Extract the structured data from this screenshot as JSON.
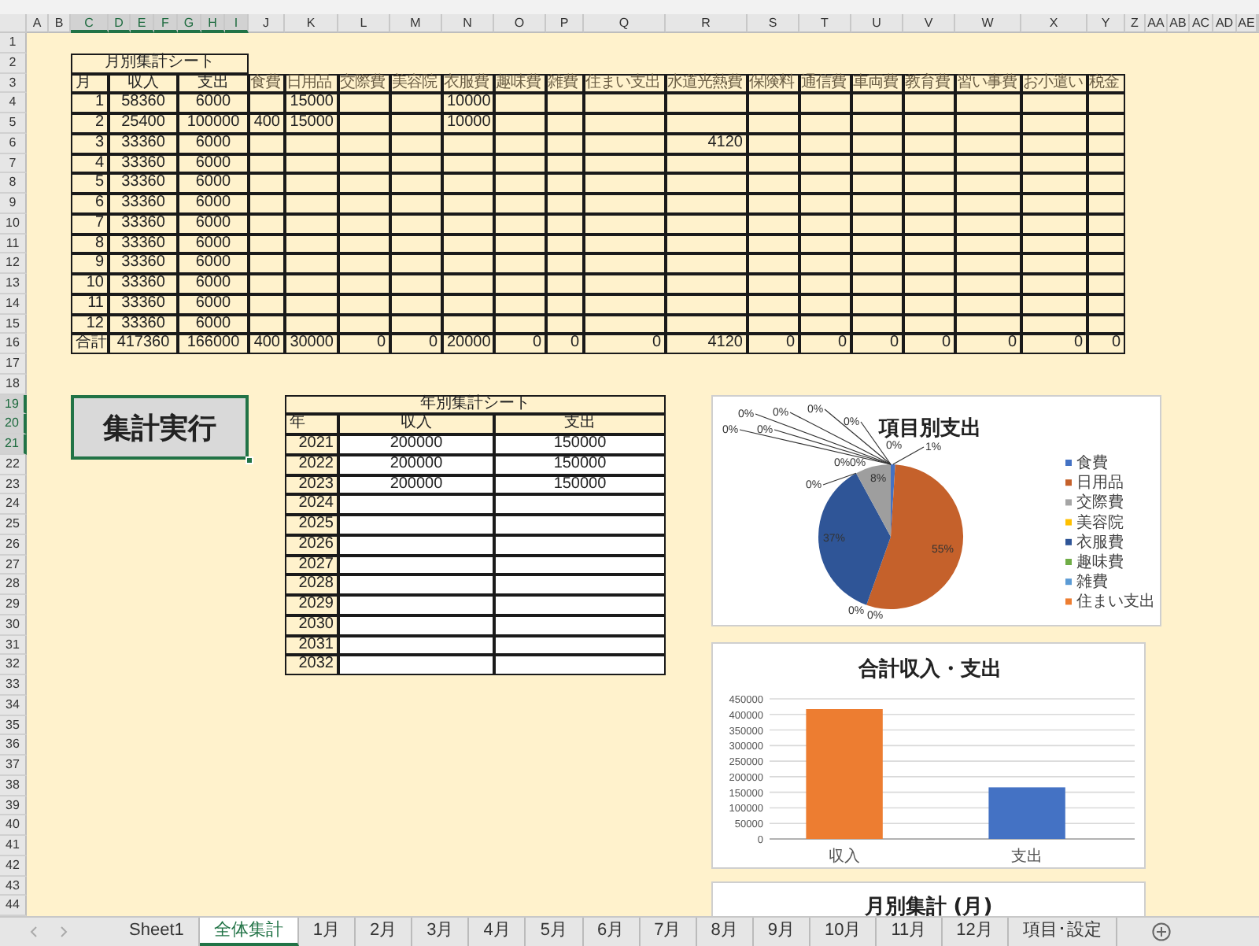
{
  "column_headers": [
    {
      "label": "A",
      "selected": false
    },
    {
      "label": "B",
      "selected": false
    },
    {
      "label": "C",
      "selected": true
    },
    {
      "label": "D",
      "selected": true
    },
    {
      "label": "E",
      "selected": true
    },
    {
      "label": "F",
      "selected": true
    },
    {
      "label": "G",
      "selected": true
    },
    {
      "label": "H",
      "selected": true
    },
    {
      "label": "I",
      "selected": true
    },
    {
      "label": "J",
      "selected": false
    },
    {
      "label": "K",
      "selected": false
    },
    {
      "label": "L",
      "selected": false
    },
    {
      "label": "M",
      "selected": false
    },
    {
      "label": "N",
      "selected": false
    },
    {
      "label": "O",
      "selected": false
    },
    {
      "label": "P",
      "selected": false
    },
    {
      "label": "Q",
      "selected": false
    },
    {
      "label": "R",
      "selected": false
    },
    {
      "label": "S",
      "selected": false
    },
    {
      "label": "T",
      "selected": false
    },
    {
      "label": "U",
      "selected": false
    },
    {
      "label": "V",
      "selected": false
    },
    {
      "label": "W",
      "selected": false
    },
    {
      "label": "X",
      "selected": false
    },
    {
      "label": "Y",
      "selected": false
    },
    {
      "label": "Z",
      "selected": false
    },
    {
      "label": "AA",
      "selected": false
    },
    {
      "label": "AB",
      "selected": false
    },
    {
      "label": "AC",
      "selected": false
    },
    {
      "label": "AD",
      "selected": false
    },
    {
      "label": "AE",
      "selected": false
    }
  ],
  "row_headers": [
    {
      "label": "1",
      "selected": false
    },
    {
      "label": "2",
      "selected": false
    },
    {
      "label": "3",
      "selected": false
    },
    {
      "label": "4",
      "selected": false
    },
    {
      "label": "5",
      "selected": false
    },
    {
      "label": "6",
      "selected": false
    },
    {
      "label": "7",
      "selected": false
    },
    {
      "label": "8",
      "selected": false
    },
    {
      "label": "9",
      "selected": false
    },
    {
      "label": "10",
      "selected": false
    },
    {
      "label": "11",
      "selected": false
    },
    {
      "label": "12",
      "selected": false
    },
    {
      "label": "13",
      "selected": false
    },
    {
      "label": "14",
      "selected": false
    },
    {
      "label": "15",
      "selected": false
    },
    {
      "label": "16",
      "selected": false
    },
    {
      "label": "17",
      "selected": false
    },
    {
      "label": "18",
      "selected": false
    },
    {
      "label": "19",
      "selected": true
    },
    {
      "label": "20",
      "selected": true
    },
    {
      "label": "21",
      "selected": true
    },
    {
      "label": "22",
      "selected": false
    },
    {
      "label": "23",
      "selected": false
    },
    {
      "label": "24",
      "selected": false
    },
    {
      "label": "25",
      "selected": false
    },
    {
      "label": "26",
      "selected": false
    },
    {
      "label": "27",
      "selected": false
    },
    {
      "label": "28",
      "selected": false
    },
    {
      "label": "29",
      "selected": false
    },
    {
      "label": "30",
      "selected": false
    },
    {
      "label": "31",
      "selected": false
    },
    {
      "label": "32",
      "selected": false
    },
    {
      "label": "33",
      "selected": false
    },
    {
      "label": "34",
      "selected": false
    },
    {
      "label": "35",
      "selected": false
    },
    {
      "label": "36",
      "selected": false
    },
    {
      "label": "37",
      "selected": false
    },
    {
      "label": "38",
      "selected": false
    },
    {
      "label": "39",
      "selected": false
    },
    {
      "label": "40",
      "selected": false
    },
    {
      "label": "41",
      "selected": false
    },
    {
      "label": "42",
      "selected": false
    },
    {
      "label": "43",
      "selected": false
    },
    {
      "label": "44",
      "selected": false
    }
  ],
  "monthly_table": {
    "title": "月別集計シート",
    "columns": [
      "月",
      "収入",
      "支出",
      "食費",
      "日用品",
      "交際費",
      "美容院",
      "衣服費",
      "趣味費",
      "雑費",
      "住まい支出",
      "水道光熱費",
      "保険料",
      "通信費",
      "車両費",
      "教育費",
      "習い事費",
      "お小遣い",
      "税金"
    ],
    "rows": [
      [
        "1",
        "58360",
        "6000",
        null,
        "15000",
        null,
        null,
        "10000",
        null,
        null,
        null,
        null,
        null,
        null,
        null,
        null,
        null,
        null,
        null
      ],
      [
        "2",
        "25400",
        "100000",
        "400",
        "15000",
        null,
        null,
        "10000",
        null,
        null,
        null,
        null,
        null,
        null,
        null,
        null,
        null,
        null,
        null
      ],
      [
        "3",
        "33360",
        "6000",
        null,
        null,
        null,
        null,
        null,
        null,
        null,
        null,
        "4120",
        null,
        null,
        null,
        null,
        null,
        null,
        null
      ],
      [
        "4",
        "33360",
        "6000",
        null,
        null,
        null,
        null,
        null,
        null,
        null,
        null,
        null,
        null,
        null,
        null,
        null,
        null,
        null,
        null
      ],
      [
        "5",
        "33360",
        "6000",
        null,
        null,
        null,
        null,
        null,
        null,
        null,
        null,
        null,
        null,
        null,
        null,
        null,
        null,
        null,
        null
      ],
      [
        "6",
        "33360",
        "6000",
        null,
        null,
        null,
        null,
        null,
        null,
        null,
        null,
        null,
        null,
        null,
        null,
        null,
        null,
        null,
        null
      ],
      [
        "7",
        "33360",
        "6000",
        null,
        null,
        null,
        null,
        null,
        null,
        null,
        null,
        null,
        null,
        null,
        null,
        null,
        null,
        null,
        null
      ],
      [
        "8",
        "33360",
        "6000",
        null,
        null,
        null,
        null,
        null,
        null,
        null,
        null,
        null,
        null,
        null,
        null,
        null,
        null,
        null,
        null
      ],
      [
        "9",
        "33360",
        "6000",
        null,
        null,
        null,
        null,
        null,
        null,
        null,
        null,
        null,
        null,
        null,
        null,
        null,
        null,
        null,
        null
      ],
      [
        "10",
        "33360",
        "6000",
        null,
        null,
        null,
        null,
        null,
        null,
        null,
        null,
        null,
        null,
        null,
        null,
        null,
        null,
        null,
        null
      ],
      [
        "11",
        "33360",
        "6000",
        null,
        null,
        null,
        null,
        null,
        null,
        null,
        null,
        null,
        null,
        null,
        null,
        null,
        null,
        null,
        null
      ],
      [
        "12",
        "33360",
        "6000",
        null,
        null,
        null,
        null,
        null,
        null,
        null,
        null,
        null,
        null,
        null,
        null,
        null,
        null,
        null,
        null
      ],
      [
        "合計",
        "417360",
        "166000",
        "400",
        "30000",
        "0",
        "0",
        "20000",
        "0",
        "0",
        "0",
        "4120",
        "0",
        "0",
        "0",
        "0",
        "0",
        "0",
        "0"
      ]
    ]
  },
  "run_button": {
    "label": "集計実行",
    "selected": true
  },
  "yearly_table": {
    "title": "年別集計シート",
    "columns": [
      "年",
      "収入",
      "支出"
    ],
    "rows": [
      [
        "2021",
        "200000",
        "150000"
      ],
      [
        "2022",
        "200000",
        "150000"
      ],
      [
        "2023",
        "200000",
        "150000"
      ],
      [
        "2024",
        null,
        null
      ],
      [
        "2025",
        null,
        null
      ],
      [
        "2026",
        null,
        null
      ],
      [
        "2027",
        null,
        null
      ],
      [
        "2028",
        null,
        null
      ],
      [
        "2029",
        null,
        null
      ],
      [
        "2030",
        null,
        null
      ],
      [
        "2031",
        null,
        null
      ],
      [
        "2032",
        null,
        null
      ]
    ]
  },
  "pie_chart": {
    "chart_data": {
      "type": "pie",
      "title": "項目別支出",
      "values": [
        1,
        55,
        0,
        0,
        37,
        0,
        0,
        0,
        8,
        0,
        0,
        0,
        0,
        0,
        0,
        0
      ],
      "value_labels": [
        "1%",
        "55%",
        "0%",
        "0%",
        "37%",
        "0%",
        "0%",
        "0%",
        "8%",
        "0%",
        "0%",
        "0%",
        "0%",
        "0%",
        "0%",
        "0%"
      ],
      "colors": [
        "#4472c4",
        "#c5612b",
        null,
        null,
        "#2f5597",
        null,
        null,
        null,
        "#9e9e9e",
        null,
        null,
        null,
        null,
        null,
        null,
        null
      ]
    },
    "legend": [
      {
        "label": "食費",
        "color": "#4472c4"
      },
      {
        "label": "日用品",
        "color": "#c5612b"
      },
      {
        "label": "交際費",
        "color": "#a5a5a5"
      },
      {
        "label": "美容院",
        "color": "#ffc000"
      },
      {
        "label": "衣服費",
        "color": "#2f5597"
      },
      {
        "label": "趣味費",
        "color": "#70ad47"
      },
      {
        "label": "雑費",
        "color": "#5b9bd5"
      },
      {
        "label": "住まい支出",
        "color": "#ed7d31"
      }
    ]
  },
  "bar_chart": {
    "chart_data": {
      "type": "bar",
      "title": "合計収入・支出",
      "categories": [
        "収入",
        "支出"
      ],
      "series": [
        {
          "values": [
            417360,
            166000
          ]
        }
      ],
      "colors": [
        "#ed7d31",
        "#4472c4"
      ],
      "grid": true,
      "ylim": [
        0,
        450000
      ],
      "yticks": [
        0,
        50000,
        100000,
        150000,
        200000,
        250000,
        300000,
        350000,
        400000,
        450000
      ]
    }
  },
  "monthly_chart": {
    "title": "月別集計 (月)"
  },
  "tabs": [
    {
      "label": "Sheet1",
      "selected": false
    },
    {
      "label": "全体集計",
      "selected": true
    },
    {
      "label": "1月",
      "selected": false
    },
    {
      "label": "2月",
      "selected": false
    },
    {
      "label": "3月",
      "selected": false
    },
    {
      "label": "4月",
      "selected": false
    },
    {
      "label": "5月",
      "selected": false
    },
    {
      "label": "6月",
      "selected": false
    },
    {
      "label": "7月",
      "selected": false
    },
    {
      "label": "8月",
      "selected": false
    },
    {
      "label": "9月",
      "selected": false
    },
    {
      "label": "10月",
      "selected": false
    },
    {
      "label": "11月",
      "selected": false
    },
    {
      "label": "12月",
      "selected": false
    },
    {
      "label": "項目･設定",
      "selected": false
    }
  ]
}
